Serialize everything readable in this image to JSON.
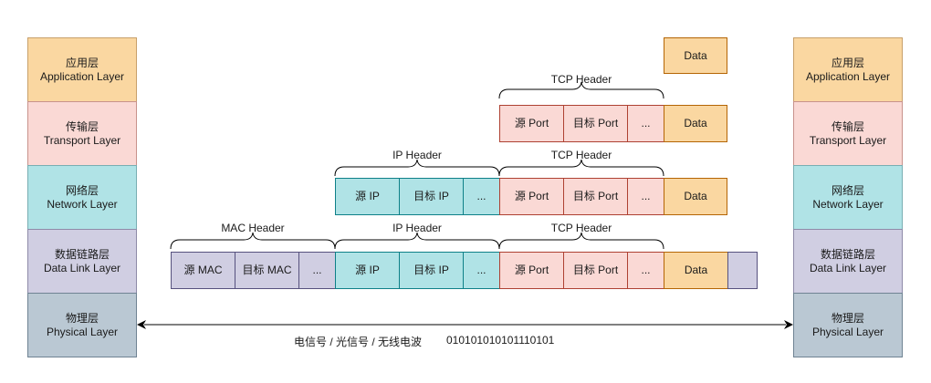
{
  "layers_left": [
    {
      "zh": "应用层",
      "en": "Application Layer"
    },
    {
      "zh": "传输层",
      "en": "Transport Layer"
    },
    {
      "zh": "网络层",
      "en": "Network Layer"
    },
    {
      "zh": "数据链路层",
      "en": "Data Link Layer"
    },
    {
      "zh": "物理层",
      "en": "Physical Layer"
    }
  ],
  "layers_right": [
    {
      "zh": "应用层",
      "en": "Application Layer"
    },
    {
      "zh": "传输层",
      "en": "Transport Layer"
    },
    {
      "zh": "网络层",
      "en": "Network Layer"
    },
    {
      "zh": "数据链路层",
      "en": "Data Link Layer"
    },
    {
      "zh": "物理层",
      "en": "Physical Layer"
    }
  ],
  "headers": {
    "mac": "MAC Header",
    "ip": "IP Header",
    "tcp": "TCP Header"
  },
  "fields": {
    "src_mac": "源 MAC",
    "dst_mac": "目标 MAC",
    "src_ip": "源 IP",
    "dst_ip": "目标 IP",
    "src_port": "源 Port",
    "dst_port": "目标 Port",
    "ellipsis": "...",
    "data": "Data"
  },
  "physical_link": {
    "medium": "电信号 / 光信号 / 无线电波",
    "bits": "010101010101110101"
  }
}
